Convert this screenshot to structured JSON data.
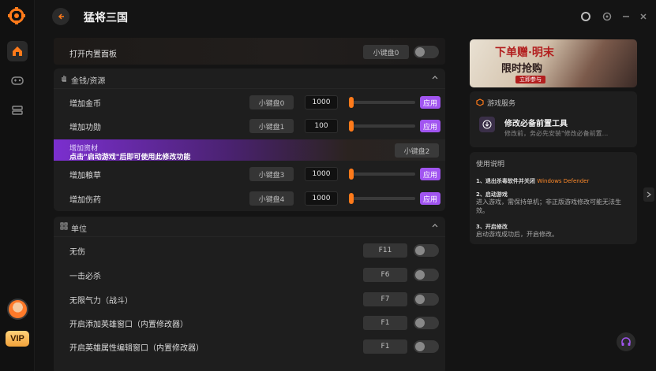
{
  "app": {
    "title": "猛将三国"
  },
  "top_row": {
    "label": "打开内置面板",
    "hotkey": "小键盘0"
  },
  "section_money": {
    "title": "金钱/资源",
    "rows": [
      {
        "label": "增加金币",
        "hotkey": "小键盘0",
        "value": "1000",
        "apply": "应用"
      },
      {
        "label": "增加功勋",
        "hotkey": "小键盘1",
        "value": "100",
        "apply": "应用"
      },
      {
        "label": "增加粮草",
        "hotkey": "小键盘3",
        "value": "1000",
        "apply": "应用"
      },
      {
        "label": "增加伤药",
        "hotkey": "小键盘4",
        "value": "1000",
        "apply": "应用"
      }
    ],
    "promo_row": {
      "label": "增加资材",
      "notice": "点击\"启动游戏\"后即可使用此修改功能",
      "hotkey": "小键盘2"
    }
  },
  "section_units": {
    "title": "单位",
    "rows": [
      {
        "label": "无伤",
        "hotkey": "F11"
      },
      {
        "label": "一击必杀",
        "hotkey": "F6"
      },
      {
        "label": "无限气力（战斗）",
        "hotkey": "F7"
      },
      {
        "label": "开启添加英雄窗口（内置修改器）",
        "hotkey": "F1"
      },
      {
        "label": "开启英雄属性编辑窗口（内置修改器）",
        "hotkey": "F1"
      }
    ]
  },
  "banner": {
    "line1": "下单赠·明末",
    "line2": "限时抢购",
    "badge": "立即参与"
  },
  "game_service": {
    "title": "游戏服务",
    "item_title": "修改必备前置工具",
    "item_desc": "修改前，务必先安装\"修改必备前置..."
  },
  "instructions": {
    "title": "使用说明",
    "step1_title": "1、退出杀毒软件并关闭",
    "step1_highlight": "Windows Defender",
    "step2_title": "2、启动游戏",
    "step2_body": "进入游戏，需保持单机；非正版游戏修改可能无法生效。",
    "step3_title": "3、开启修改",
    "step3_body": "启动游戏成功后，开启修改。"
  },
  "colors": {
    "accent_orange": "#ff7a1a",
    "accent_purple": "#a155f0",
    "highlight_text": "#ff8a2a"
  },
  "icons": [
    "logo-icon",
    "home-icon",
    "gamepad-icon",
    "stack-icon",
    "back-arrow-icon",
    "record-icon",
    "settings-icon",
    "minimize-icon",
    "close-icon",
    "hand-icon",
    "chevron-up-icon",
    "grid-icon",
    "cube-icon",
    "download-icon",
    "chevron-right-icon",
    "headset-icon"
  ],
  "rail": {
    "vip_label": "VIP"
  }
}
